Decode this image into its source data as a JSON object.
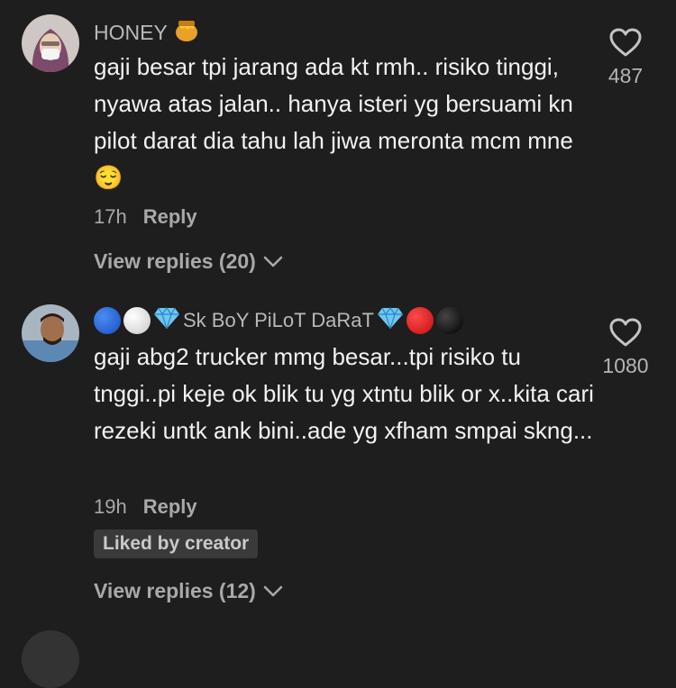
{
  "comments": [
    {
      "username": "HONEY",
      "text": "gaji besar tpi jarang ada kt rmh.. risiko tinggi, nyawa atas jalan.. hanya isteri yg bersuami kn pilot darat dia tahu lah jiwa meronta mcm mne",
      "emoji": "😌",
      "time": "17h",
      "reply_label": "Reply",
      "likes": "487",
      "view_replies": "View replies (20)"
    },
    {
      "username": "Sk BoY PiLoT DaRaT",
      "text": "gaji abg2 trucker mmg besar...tpi risiko tu tnggi..pi keje ok blik tu yg xtntu blik or x..kita cari rezeki untk ank bini..ade yg xfham smpai skng...",
      "time": "19h",
      "reply_label": "Reply",
      "likes": "1080",
      "badge": "Liked by creator",
      "view_replies": "View replies (12)"
    }
  ],
  "colors": {
    "background": "#1e1e1e",
    "secondary_text": "#a9a9a9",
    "badge_bg": "#3a3a3a"
  }
}
